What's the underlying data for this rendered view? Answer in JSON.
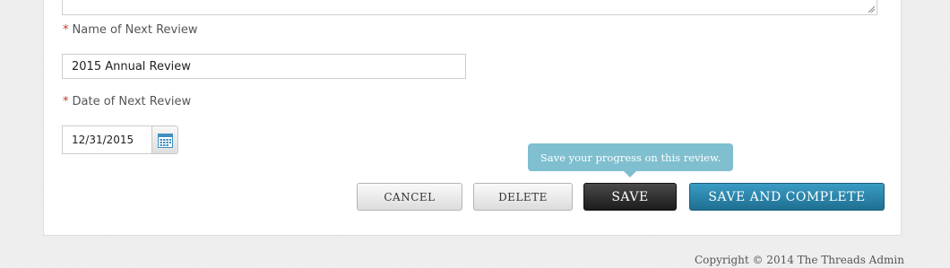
{
  "form": {
    "name_label": "Name of Next Review",
    "name_value": "2015 Annual Review",
    "date_label": "Date of Next Review",
    "date_value": "12/31/2015",
    "required_marker": "*",
    "calendar_icon": "calendar-icon"
  },
  "actions": {
    "cancel_label": "CANCEL",
    "delete_label": "DELETE",
    "save_label": "SAVE",
    "save_complete_label": "SAVE AND COMPLETE",
    "save_tooltip": "Save your progress on this review."
  },
  "footer": {
    "copyright": "Copyright © 2014 The Threads Admin"
  },
  "colors": {
    "required": "#c0392b",
    "primary": "#2a84aa",
    "dark_button": "#2b2b2b",
    "tooltip": "#7fbfcf"
  }
}
